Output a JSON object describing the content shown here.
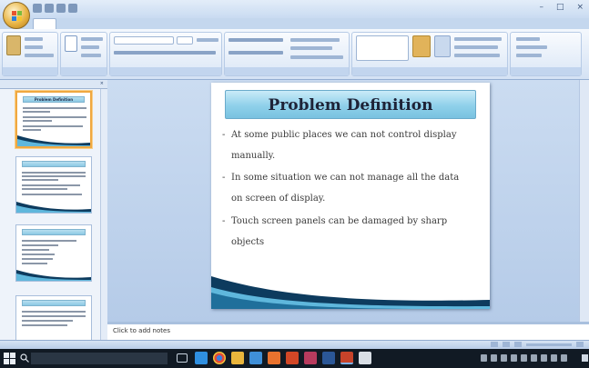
{
  "window": {
    "title": "",
    "controls": [
      "–",
      "□",
      "×"
    ]
  },
  "ribbon": {
    "tabs": [
      "",
      "",
      "",
      "",
      "",
      "",
      ""
    ],
    "groups": [
      "",
      "",
      "",
      "",
      "",
      ""
    ]
  },
  "slides_pane": {
    "tab_slides": "",
    "tab_outline": "",
    "thumbnails": [
      {
        "num": "",
        "title": "Problem Definition",
        "selected": true
      },
      {
        "num": "",
        "title": "",
        "selected": false
      },
      {
        "num": "",
        "title": "",
        "selected": false
      },
      {
        "num": "",
        "title": "",
        "selected": false
      }
    ]
  },
  "slide": {
    "title": "Problem Definition",
    "bullets": [
      {
        "marker": "-",
        "lines": [
          "At some public places we can not control display",
          "manually."
        ]
      },
      {
        "marker": "-",
        "lines": [
          "In some situation we can not manage all the data",
          "on screen of display."
        ]
      },
      {
        "marker": "-",
        "lines": [
          "Touch screen panels can be damaged by sharp",
          "objects"
        ]
      }
    ]
  },
  "notes": {
    "placeholder": "Click to add notes"
  },
  "statusbar": {
    "left_text": ""
  },
  "taskbar": {
    "search_placeholder": "",
    "clock_time": "",
    "clock_date": ""
  },
  "colors": {
    "title_box": "#8fd0ea",
    "selected_border": "#f0a840",
    "wave_dark": "#0d3b5e",
    "wave_light": "#5fb7dc"
  }
}
